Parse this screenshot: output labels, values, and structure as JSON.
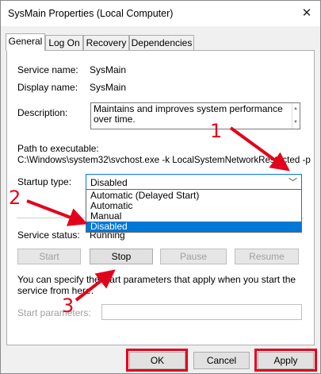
{
  "window": {
    "title": "SysMain Properties (Local Computer)",
    "close_glyph": "✕"
  },
  "tabs": [
    {
      "label": "General",
      "active": true
    },
    {
      "label": "Log On",
      "active": false
    },
    {
      "label": "Recovery",
      "active": false
    },
    {
      "label": "Dependencies",
      "active": false
    }
  ],
  "general": {
    "service_name_label": "Service name:",
    "service_name_value": "SysMain",
    "display_name_label": "Display name:",
    "display_name_value": "SysMain",
    "description_label": "Description:",
    "description_value": "Maintains and improves system performance over time.",
    "path_label": "Path to executable:",
    "path_value": "C:\\Windows\\system32\\svchost.exe -k LocalSystemNetworkRestricted -p",
    "startup_label": "Startup type:",
    "startup_value": "Disabled",
    "startup_options": [
      "Automatic (Delayed Start)",
      "Automatic",
      "Manual",
      "Disabled"
    ],
    "startup_selected_index": 3,
    "status_label": "Service status:",
    "status_value": "Running",
    "buttons": {
      "start": "Start",
      "stop": "Stop",
      "pause": "Pause",
      "resume": "Resume"
    },
    "hint": "You can specify the start parameters that apply when you start the service from here.",
    "params_label": "Start parameters:",
    "params_value": ""
  },
  "footer": {
    "ok": "OK",
    "cancel": "Cancel",
    "apply": "Apply"
  },
  "annotations": {
    "color": "#e3001b",
    "step1": "1",
    "step2": "2",
    "step3": "3"
  },
  "icons": {
    "close": "close-icon",
    "dropdown": "chevron-down-icon"
  }
}
